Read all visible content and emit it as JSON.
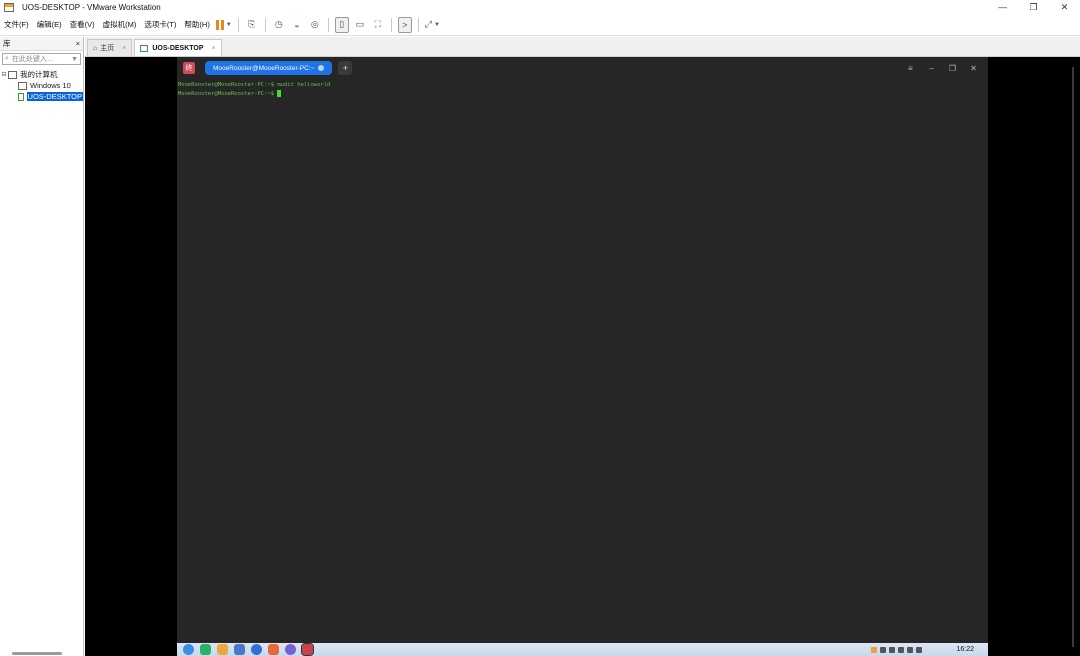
{
  "window": {
    "title": "UOS-DESKTOP - VMware Workstation",
    "controls": {
      "minimize": "—",
      "restore": "❐",
      "close": "✕"
    }
  },
  "menu": {
    "items": [
      "文件(F)",
      "编辑(E)",
      "查看(V)",
      "虚拟机(M)",
      "选项卡(T)",
      "帮助(H)"
    ]
  },
  "toolbar": {
    "icons": [
      "pause-icon",
      "send-keys-icon",
      "snapshot-icon",
      "revert-snapshot-icon",
      "snapshot-manager-icon",
      "library-view-icon",
      "thumbnail-view-icon",
      "fullscreen-icon",
      "console-icon",
      "stretch-icon"
    ],
    "accent": "#e8891f"
  },
  "library": {
    "title": "库",
    "close": "×",
    "search_placeholder": "在此处键入...",
    "tree": {
      "root": "我的计算机",
      "items": [
        "Windows 10",
        "UOS-DESKTOP"
      ],
      "selected_color": "#0a64d6"
    }
  },
  "tabs": [
    {
      "label": "主页",
      "close": "×"
    },
    {
      "label": "UOS-DESKTOP",
      "close": "×"
    }
  ],
  "terminal": {
    "logo": "终",
    "tab_title": "MooeRooster@MooeRooster-PC:~",
    "add": "+",
    "controls": [
      "≡",
      "–",
      "❐",
      "✕"
    ],
    "lines": [
      "MooeRooster@MooeRooster-PC:~$ mudit helloworld",
      "MooeRooster@MooeRooster-PC:~$"
    ],
    "text_color": "#63c04e",
    "bg_color": "#262626",
    "tab_color": "#1f73e8"
  },
  "taskbar": {
    "icons": [
      "launcher-icon",
      "app-store-icon",
      "file-manager-icon",
      "trash-icon",
      "browser-icon",
      "mail-icon",
      "settings-icon",
      "terminal-icon"
    ],
    "clock": "16:22"
  }
}
